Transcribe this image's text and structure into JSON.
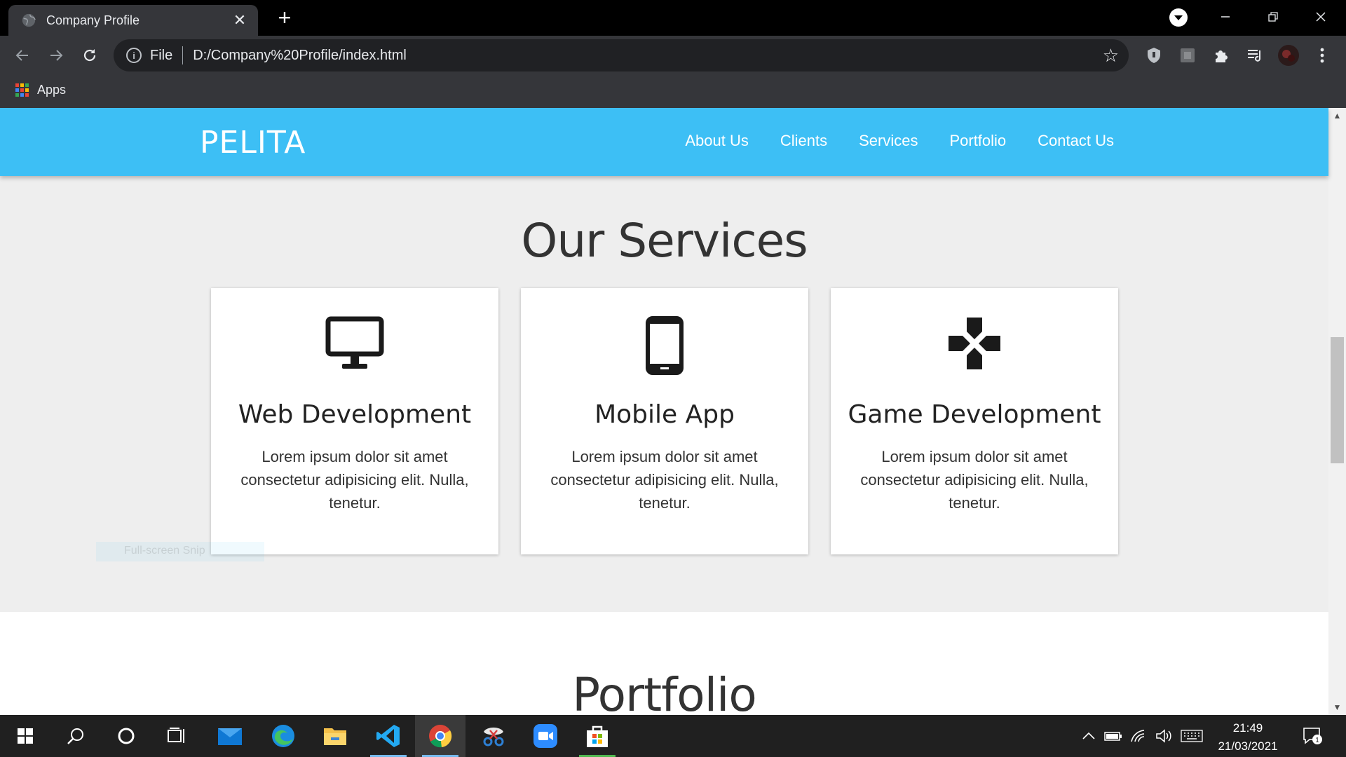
{
  "browser": {
    "tab_title": "Company Profile",
    "close_symbol": "✕",
    "new_tab_symbol": "+",
    "url_scheme_label": "File",
    "url": "D:/Company%20Profile/index.html",
    "bookmark_apps_label": "Apps"
  },
  "page": {
    "brand": "PELITA",
    "nav": [
      "About Us",
      "Clients",
      "Services",
      "Portfolio",
      "Contact Us"
    ],
    "services_heading": "Our Services",
    "services": [
      {
        "icon": "desktop-icon",
        "title": "Web Development",
        "text": "Lorem ipsum dolor sit amet consectetur adipisicing elit. Nulla, tenetur."
      },
      {
        "icon": "mobile-icon",
        "title": "Mobile App",
        "text": "Lorem ipsum dolor sit amet consectetur adipisicing elit. Nulla, tenetur."
      },
      {
        "icon": "gamepad-icon",
        "title": "Game Development",
        "text": "Lorem ipsum dolor sit amet consectetur adipisicing elit. Nulla, tenetur."
      }
    ],
    "portfolio_heading": "Portfolio",
    "ghost_text": "Full-screen Snip"
  },
  "taskbar": {
    "time": "21:49",
    "date": "21/03/2021",
    "notification_count": "1"
  },
  "colors": {
    "navbar": "#3dbff5",
    "page_bg": "#eeeeee",
    "chrome_dark": "#35363a"
  }
}
